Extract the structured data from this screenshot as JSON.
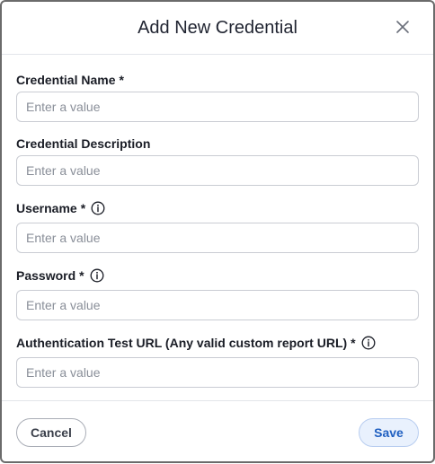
{
  "dialog": {
    "title": "Add New Credential"
  },
  "fields": {
    "name": {
      "label": "Credential Name",
      "required_mark": "*",
      "placeholder": "Enter a value",
      "value": ""
    },
    "description": {
      "label": "Credential Description",
      "placeholder": "Enter a value",
      "value": ""
    },
    "username": {
      "label": "Username",
      "required_mark": "*",
      "placeholder": "Enter a value",
      "value": "",
      "icon": "info-icon"
    },
    "password": {
      "label": "Password",
      "required_mark": "*",
      "placeholder": "Enter a value",
      "value": "",
      "icon": "info-icon"
    },
    "auth_url": {
      "label": "Authentication Test URL (Any valid custom report URL)",
      "required_mark": "*",
      "placeholder": "Enter a value",
      "value": "",
      "icon": "info-icon"
    }
  },
  "footer": {
    "cancel_label": "Cancel",
    "save_label": "Save"
  },
  "colors": {
    "save_text": "#1f5fc1",
    "save_bg": "#e9f1fd",
    "border": "#c9ccd3"
  }
}
